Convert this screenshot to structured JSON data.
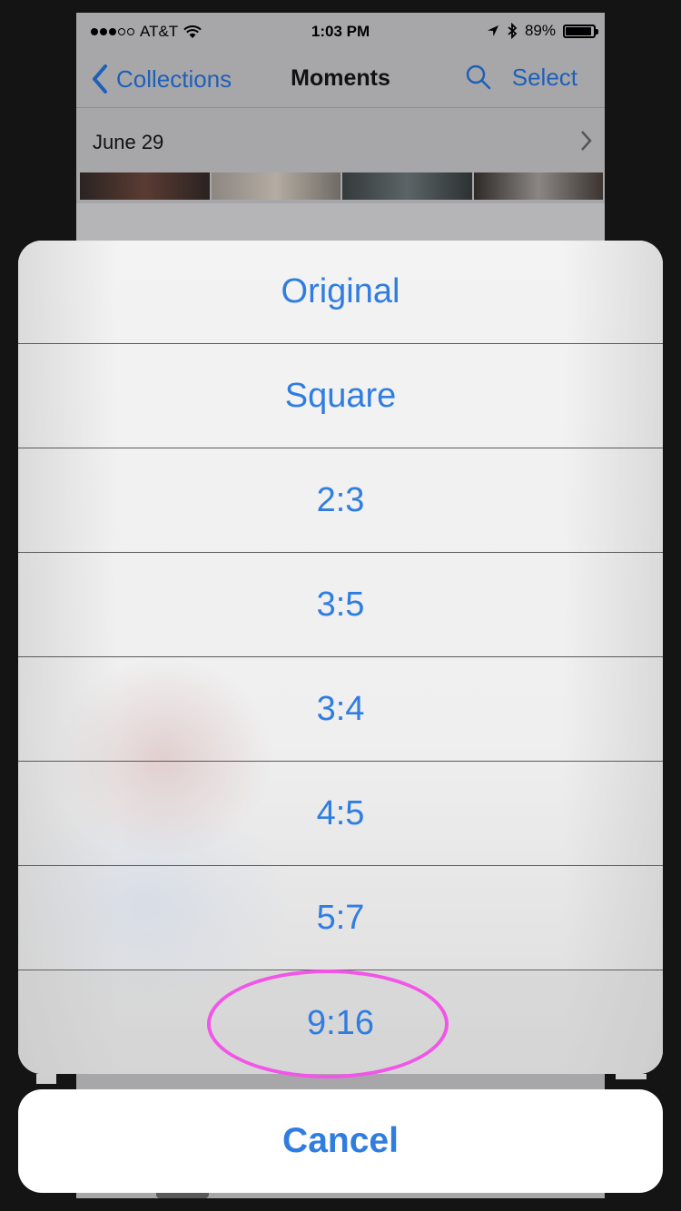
{
  "status_bar": {
    "carrier": "AT&T",
    "time": "1:03 PM",
    "battery": "89%",
    "battery_level": 0.89
  },
  "nav": {
    "back_label": "Collections",
    "title": "Moments",
    "select_label": "Select"
  },
  "moments": [
    {
      "label": "June 29"
    }
  ],
  "action_sheet": {
    "options": [
      "Original",
      "Square",
      "2:3",
      "3:5",
      "3:4",
      "4:5",
      "5:7",
      "9:16"
    ],
    "highlighted": "9:16",
    "cancel_label": "Cancel"
  },
  "colors": {
    "accent": "#2f7de1",
    "highlight_ring": "#f255e8",
    "dim_background": "#141414"
  }
}
